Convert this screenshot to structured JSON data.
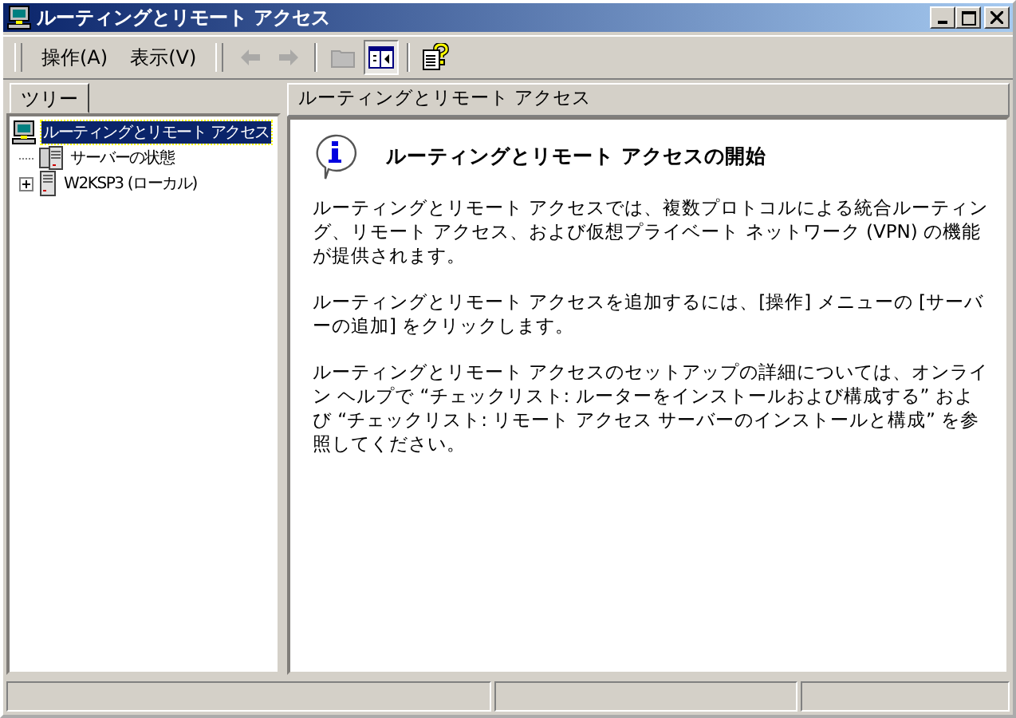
{
  "window": {
    "title": "ルーティングとリモート アクセス"
  },
  "menu": [
    {
      "label": "操作(A)"
    },
    {
      "label": "表示(V)"
    }
  ],
  "toolbar_buttons": [
    {
      "kind": "back",
      "disabled": true,
      "pressed": false
    },
    {
      "kind": "forward",
      "disabled": true,
      "pressed": false
    },
    {
      "kind": "up",
      "disabled": true,
      "pressed": false
    },
    {
      "kind": "tree",
      "disabled": false,
      "pressed": true
    },
    {
      "kind": "help",
      "disabled": false,
      "pressed": false
    }
  ],
  "tabs": [
    {
      "label": "ツリー",
      "selected": true
    }
  ],
  "tree": [
    {
      "label": "ルーティングとリモート アクセス",
      "kind": "root",
      "selected": true,
      "children": [
        {
          "label": "サーバーの状態",
          "kind": "servers",
          "selected": false
        },
        {
          "label": "W2KSP3 (ローカル)",
          "kind": "server",
          "selected": false,
          "expanded": false
        }
      ]
    }
  ],
  "content": {
    "header": "ルーティングとリモート アクセス",
    "title": "ルーティングとリモート アクセスの開始",
    "paragraphs": [
      "ルーティングとリモート アクセスでは、複数プロトコルによる統合ルーティング、リモート アクセス、および仮想プライベート ネットワーク (VPN) の機能が提供されます。",
      "ルーティングとリモート アクセスを追加するには、[操作] メニューの [サーバーの追加] をクリックします。",
      "ルーティングとリモート アクセスのセットアップの詳細については、オンライン ヘルプで “チェックリスト: ルーターをインストールおよび構成する” および “チェックリスト: リモート アクセス サーバーのインストールと構成” を参照してください。"
    ]
  }
}
